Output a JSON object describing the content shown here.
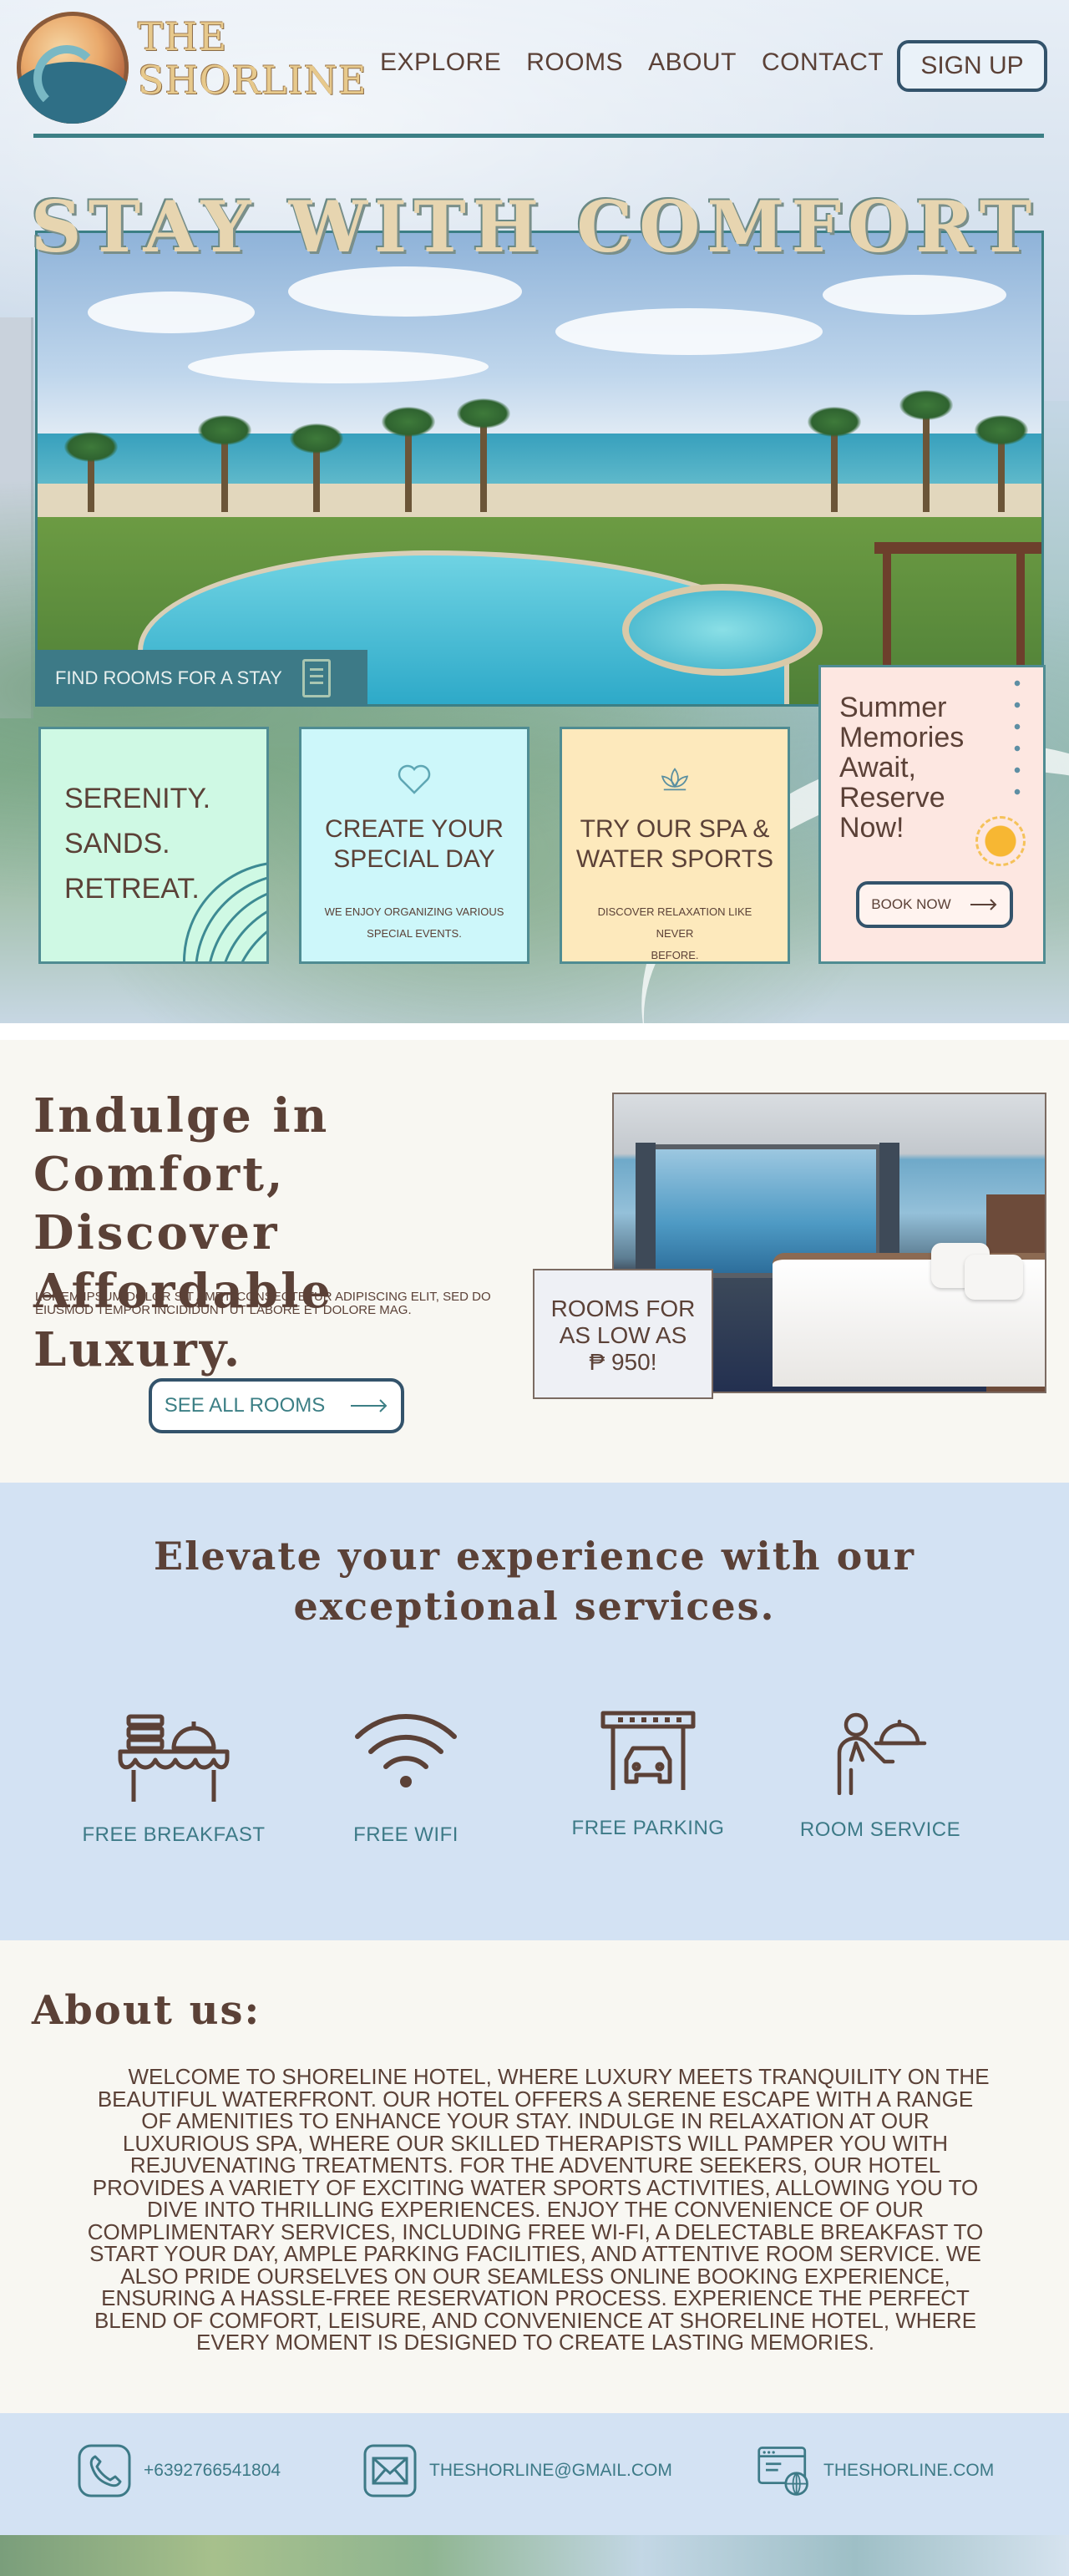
{
  "brand": {
    "name_line1": "THE",
    "name_line2": "SHORLINE"
  },
  "nav": {
    "items": [
      "EXPLORE",
      "ROOMS",
      "ABOUT",
      "CONTACT"
    ],
    "signup_label": "SIGN UP"
  },
  "hero": {
    "title": "STAY WITH COMFORT",
    "find_rooms_label": "FIND ROOMS FOR A STAY"
  },
  "cards": [
    {
      "line1": "SERENITY.",
      "line2": "SANDS.",
      "line3": "RETREAT."
    },
    {
      "title_line1": "CREATE YOUR",
      "title_line2": "SPECIAL DAY",
      "subtitle_line1": "WE ENJOY ORGANIZING VARIOUS",
      "subtitle_line2": "SPECIAL EVENTS."
    },
    {
      "title_line1": "TRY OUR SPA &",
      "title_line2": "WATER SPORTS",
      "subtitle_line1": "DISCOVER RELAXATION LIKE NEVER",
      "subtitle_line2": "BEFORE."
    }
  ],
  "promo": {
    "lines": [
      "Summer",
      "Memories",
      "Await,",
      "Reserve",
      "Now!"
    ],
    "button_label": "BOOK NOW"
  },
  "indulge": {
    "heading_line1": "Indulge in Comfort,",
    "heading_line2": "Discover Affordable",
    "heading_line3": "Luxury.",
    "lorem": "Lorem ipsum dolor sit amet, consectetur adipiscing elit, sed do eiusmod tempor incididunt ut labore et dolore mag.",
    "button_label": "SEE ALL ROOMS",
    "price_line1": "ROOMS FOR",
    "price_line2": "AS LOW AS",
    "price_line3": "₱ 950!"
  },
  "services": {
    "heading_line1": "Elevate your experience with our",
    "heading_line2": "exceptional services.",
    "items": [
      {
        "label": "FREE BREAKFAST",
        "icon": "breakfast-icon"
      },
      {
        "label": "FREE WIFI",
        "icon": "wifi-icon"
      },
      {
        "label": "FREE PARKING",
        "icon": "parking-icon"
      },
      {
        "label": "ROOM SERVICE",
        "icon": "room-service-icon"
      }
    ]
  },
  "about": {
    "heading": "About us:",
    "body": "Welcome to Shoreline Hotel, where luxury meets tranquility on the beautiful waterfront. Our hotel offers a serene escape with a range of amenities to enhance your stay. Indulge in relaxation at our luxurious spa, where our skilled therapists will pamper you with rejuvenating treatments. For the adventure seekers, our hotel provides a variety of exciting water sports activities, allowing you to dive into thrilling experiences. Enjoy the convenience of our complimentary services, including free Wi-Fi, a delectable breakfast to start your day, ample parking facilities, and attentive room service. We also pride ourselves on our seamless online booking experience, ensuring a hassle-free reservation process. Experience the perfect blend of comfort, leisure, and convenience at Shoreline Hotel, where every moment is designed to create lasting memories."
  },
  "contact": {
    "phone": "+6392766541804",
    "email": "THESHORLINE@GMAIL.COM",
    "website": "THESHORLINE.COM"
  },
  "colors": {
    "text_brown": "#5b4137",
    "teal": "#3c7f85",
    "navy_border": "#33536b",
    "mint_card": "#cff9e4",
    "aqua_card": "#cdf7fa",
    "sand_card": "#fde9bc",
    "pink_card": "#fde7e1",
    "services_bg": "#d3e2f3"
  }
}
